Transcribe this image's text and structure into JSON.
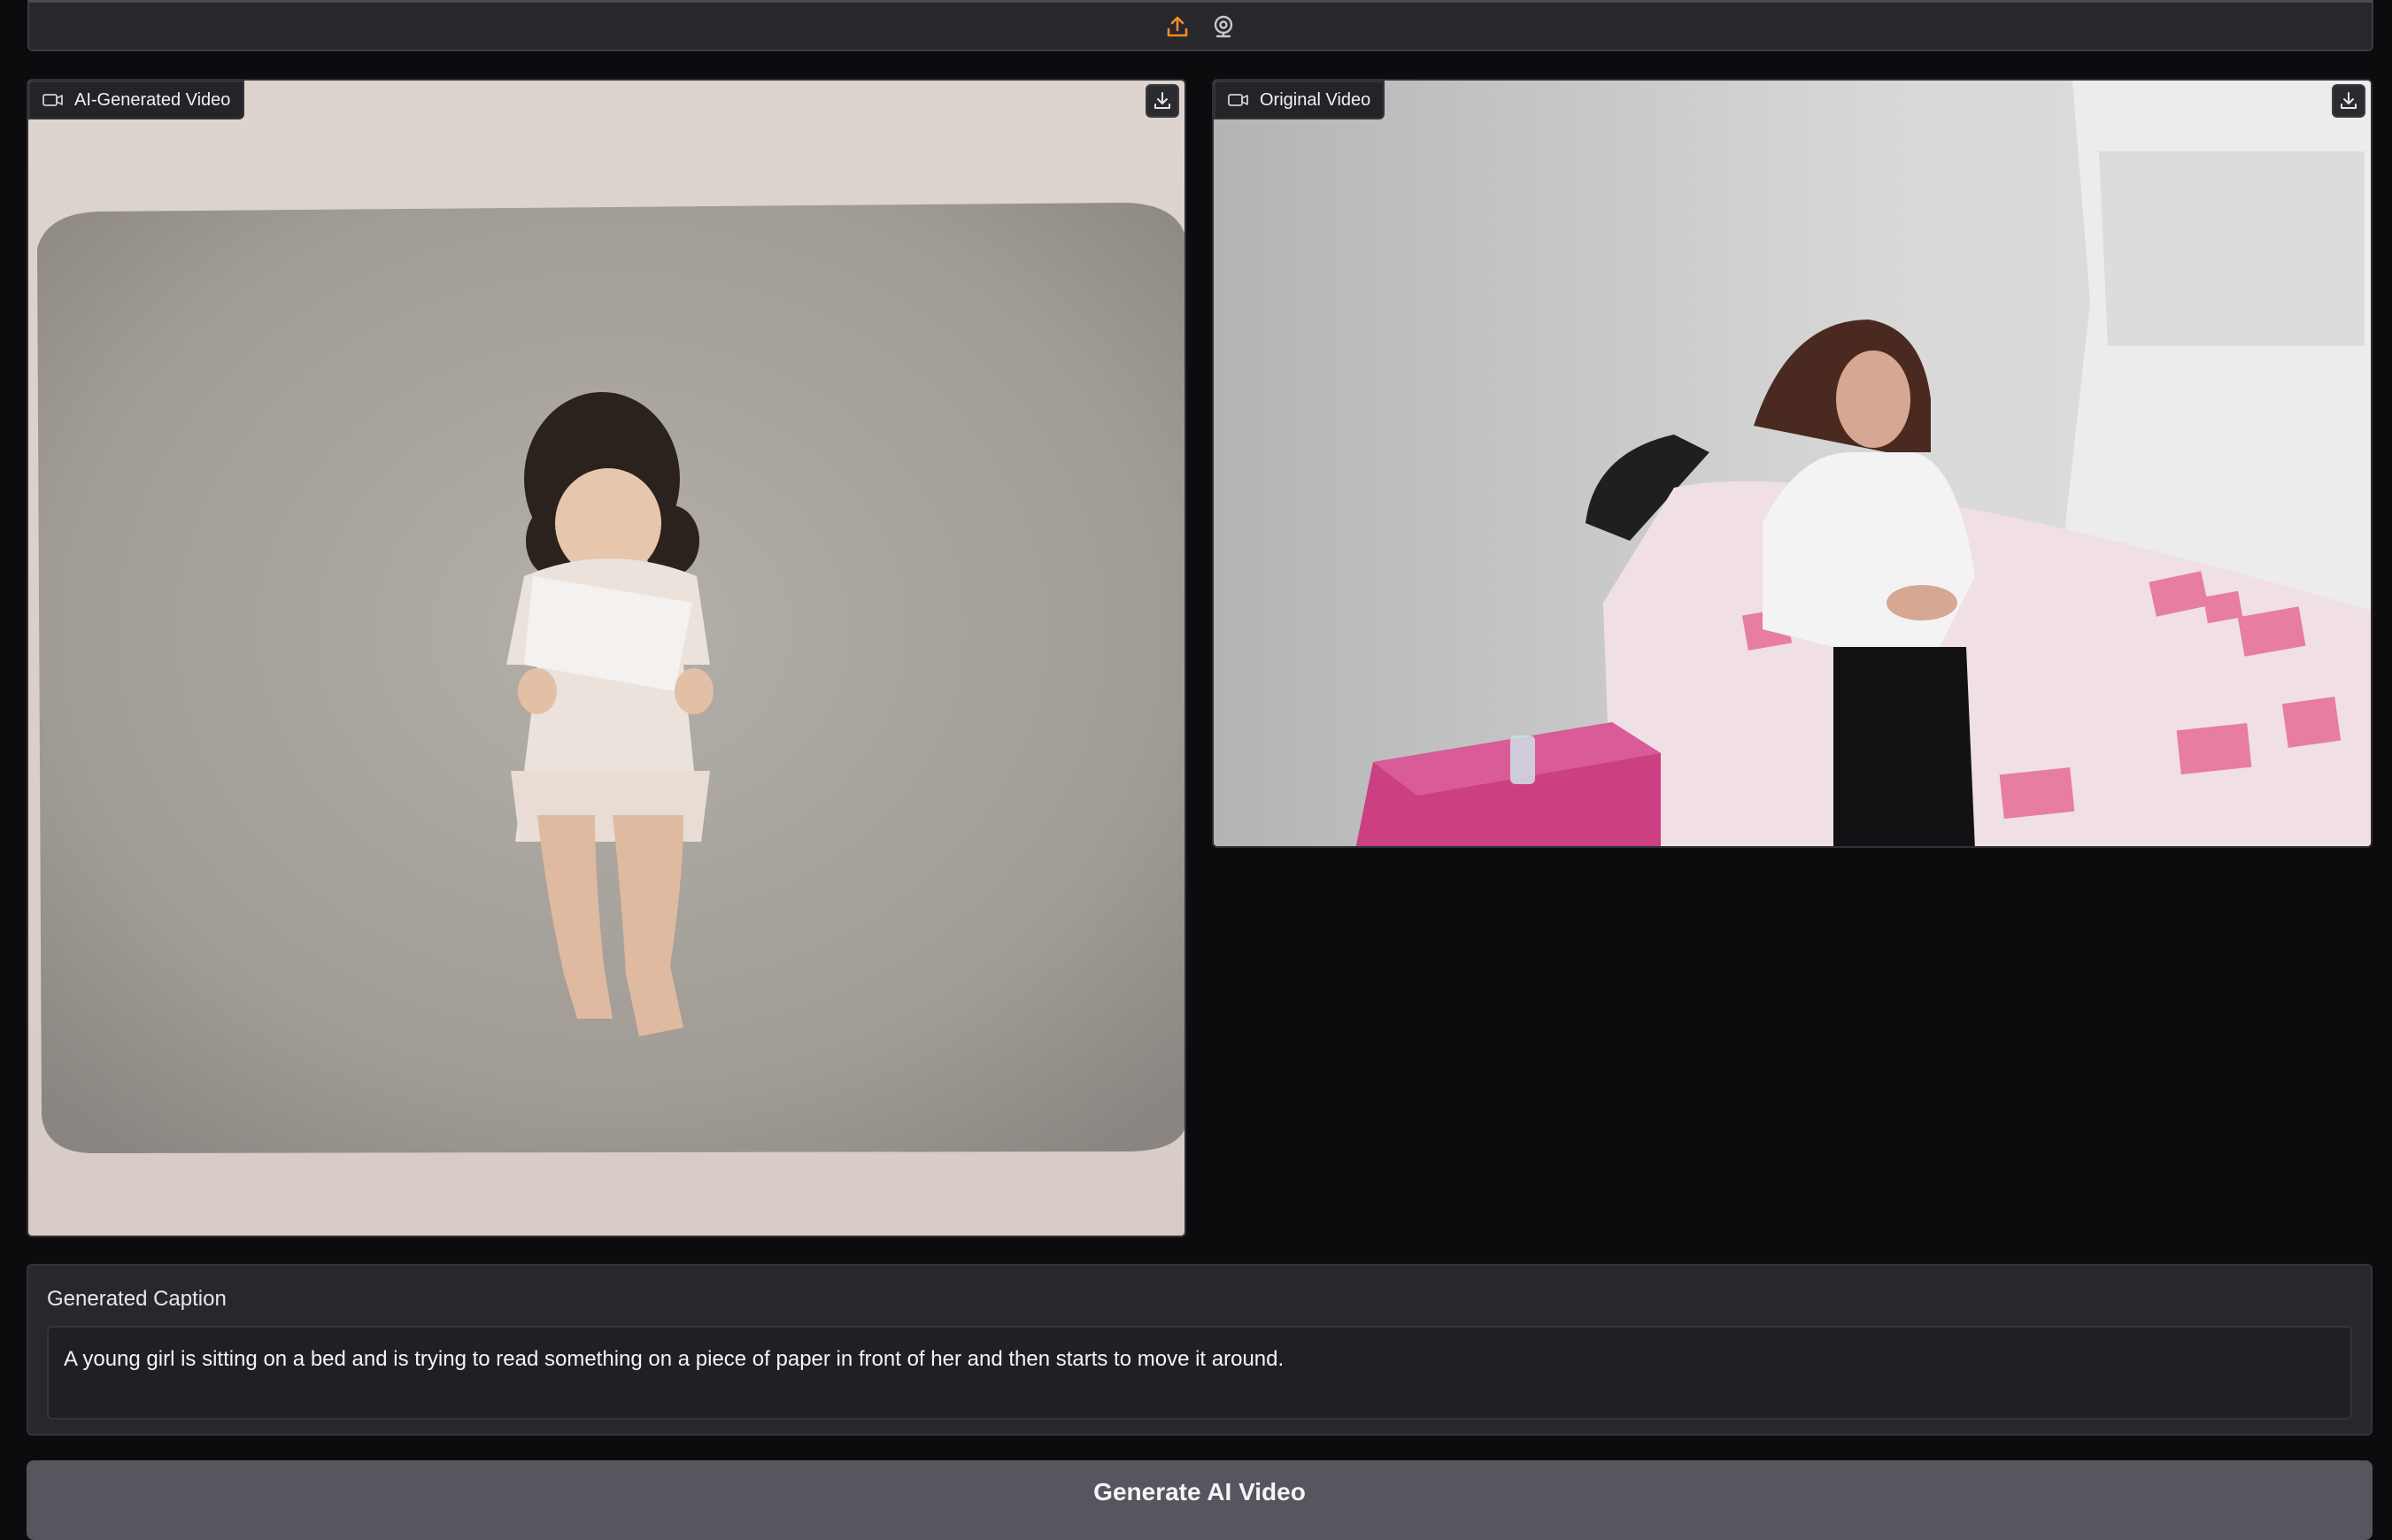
{
  "toolbar": {
    "icons": [
      "upload-icon",
      "webcam-icon"
    ],
    "accent": "#f28c28"
  },
  "ai_video": {
    "label": "AI-Generated Video",
    "icon": "video-camera-icon",
    "download_icon": "download-icon"
  },
  "original_video": {
    "label": "Original Video",
    "icon": "video-camera-icon",
    "download_icon": "download-icon"
  },
  "caption": {
    "label": "Generated Caption",
    "value": "A young girl is sitting on a bed and is trying to read something on a piece of paper in front of her and then starts to move it around."
  },
  "actions": {
    "generate_label": "Generate AI Video"
  }
}
